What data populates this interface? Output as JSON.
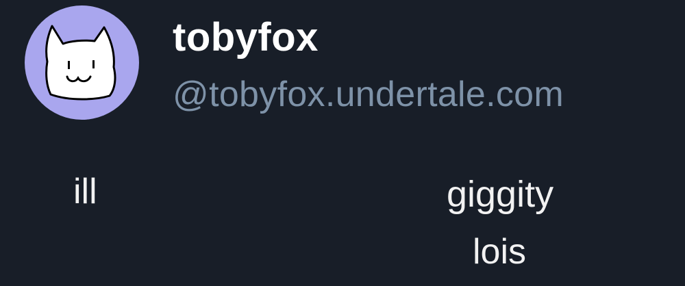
{
  "profile": {
    "display_name": "tobyfox",
    "handle": "@tobyfox.undertale.com",
    "avatar_icon": "white-cat-drawing-icon",
    "avatar_bg_color": "#a9a6ee"
  },
  "post": {
    "words": {
      "ill": "ill",
      "giggity": "giggity",
      "lois": "lois"
    }
  },
  "colors": {
    "background": "#181e28",
    "name": "#ffffff",
    "handle": "#7e92a8",
    "text": "#f2f2f2"
  }
}
